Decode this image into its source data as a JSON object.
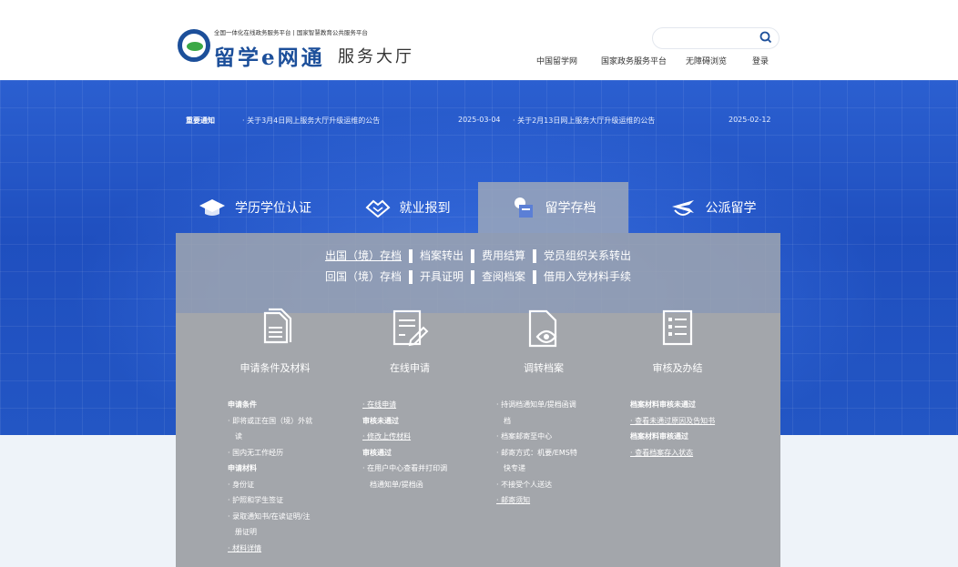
{
  "header": {
    "logo_small": "全国一体化在线政务服务平台 | 国家智慧教育公共服务平台",
    "logo_text": "留学e网通",
    "logo_sub": "服务大厅",
    "search_placeholder": "",
    "nav": [
      "中国留学网",
      "国家政务服务平台",
      "无障碍浏览",
      "登录"
    ]
  },
  "notices": {
    "label": "重要通知",
    "items": [
      {
        "title": "· 关于3月4日网上服务大厅升级运维的公告",
        "date": "2025-03-04"
      },
      {
        "title": "· 关于2月13日网上服务大厅升级运维的公告",
        "date": "2025-02-12"
      }
    ]
  },
  "tabs": [
    {
      "label": "学历学位认证",
      "icon": "graduation-cap-icon"
    },
    {
      "label": "就业报到",
      "icon": "handshake-icon"
    },
    {
      "label": "留学存档",
      "icon": "archive-icon",
      "active": true
    },
    {
      "label": "公派留学",
      "icon": "plane-icon"
    }
  ],
  "links": {
    "row1": [
      "出国（境）存档",
      "档案转出",
      "费用结算",
      "党员组织关系转出"
    ],
    "row2": [
      "回国（境）存档",
      "开具证明",
      "查阅档案",
      "借用入党材料手续"
    ]
  },
  "steps": [
    {
      "label": "申请条件及材料",
      "icon": "documents-icon"
    },
    {
      "label": "在线申请",
      "icon": "form-edit-icon"
    },
    {
      "label": "调转档案",
      "icon": "file-eye-icon"
    },
    {
      "label": "审核及办结",
      "icon": "checklist-icon"
    }
  ],
  "columns": {
    "col1": [
      "申请条件",
      "· 即将或正在国（境）外就",
      "读",
      "· 国内无工作经历",
      "申请材料",
      "· 身份证",
      "· 护照和学生签证",
      "· 录取通知书/在读证明/注",
      "册证明",
      "· 材料详情"
    ],
    "col2": [
      "· 在线申请",
      "审核未通过",
      "· 修改上传材料",
      "审核通过",
      "· 在用户中心查看并打印调",
      "档通知单/提档函"
    ],
    "col3": [
      "· 持调档通知单/提档函调",
      "档",
      "· 档案邮寄至中心",
      "· 邮寄方式：机要/EMS特",
      "快专递",
      "· 不接受个人送达",
      "· 邮寄须知"
    ],
    "col4": [
      "档案材料审核未通过",
      "· 查看未通过原因及告知书",
      "档案材料审核通过",
      "· 查看档案存入状态"
    ]
  },
  "colors": {
    "primary": "#1c4f9a",
    "accent_green": "#3aa845",
    "banner_blue": "#2356c4",
    "panel_gray": "#a3a6ab"
  }
}
